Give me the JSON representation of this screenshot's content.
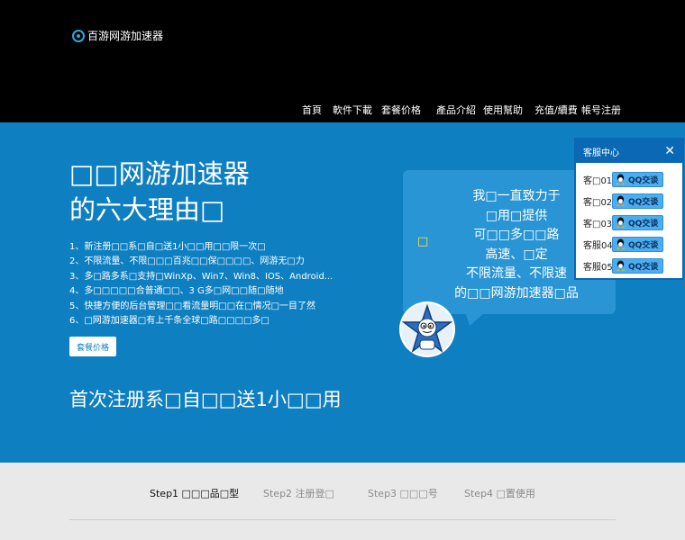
{
  "header": {
    "logo_text": "百游网游加速器",
    "logo_icon": "circle-logo-icon",
    "nav": [
      "首頁",
      "軟件下載",
      "套餐价格",
      "產品介紹",
      "使用幫助",
      "充值/續費",
      "帳号注册"
    ]
  },
  "hero": {
    "title_line1": "□□网游加速器",
    "title_line2": "的六大理由□",
    "features": [
      "1、新注册□□系□自□送1小□□用□□限一次□",
      "2、不限流量、不限□□□百兆□□保□□□□、网游无□力",
      "3、多□路多系□支持□WinXp、Win7、Win8、IOS、Android...",
      "4、多□□□□□合普通□□、3 G多□网□□随□随地",
      "5、快捷方便的后台管理□□看流量明□□在□情况□一目了然",
      "6、□网游加速器□有上千条全球□路□□□□多□"
    ],
    "plan_button": "套餐价格",
    "free_trial": "首次注册系□自□□送1小□□用"
  },
  "bubble": {
    "lines": [
      "我□一直致力于",
      "□用□提供",
      "可□□多□□路",
      "高速、□定",
      "不限流量、不限速",
      "的□□网游加速器□品"
    ],
    "glyph": "□"
  },
  "service": {
    "title": "客服中心",
    "close": "✕",
    "agents": [
      {
        "label": "客□01□",
        "button": "QQ交谈"
      },
      {
        "label": "客□02□",
        "button": "QQ交谈"
      },
      {
        "label": "客□03□",
        "button": "QQ交谈"
      },
      {
        "label": "客服04□",
        "button": "QQ交谈"
      },
      {
        "label": "客服05□",
        "button": "QQ交谈"
      }
    ]
  },
  "steps": {
    "items": [
      {
        "label": "Step1 □□□品□型",
        "active": true
      },
      {
        "label": "Step2 注册登□",
        "active": false
      },
      {
        "label": "Step3 □□□号",
        "active": false
      },
      {
        "label": "Step4 □置使用",
        "active": false
      }
    ]
  },
  "colors": {
    "header_bg": "#000000",
    "hero_bg": "#0e7fc1",
    "bubble_bg": "#2a95d4",
    "service_accent": "#0a68b4",
    "steps_bg": "#e9e9e9"
  }
}
